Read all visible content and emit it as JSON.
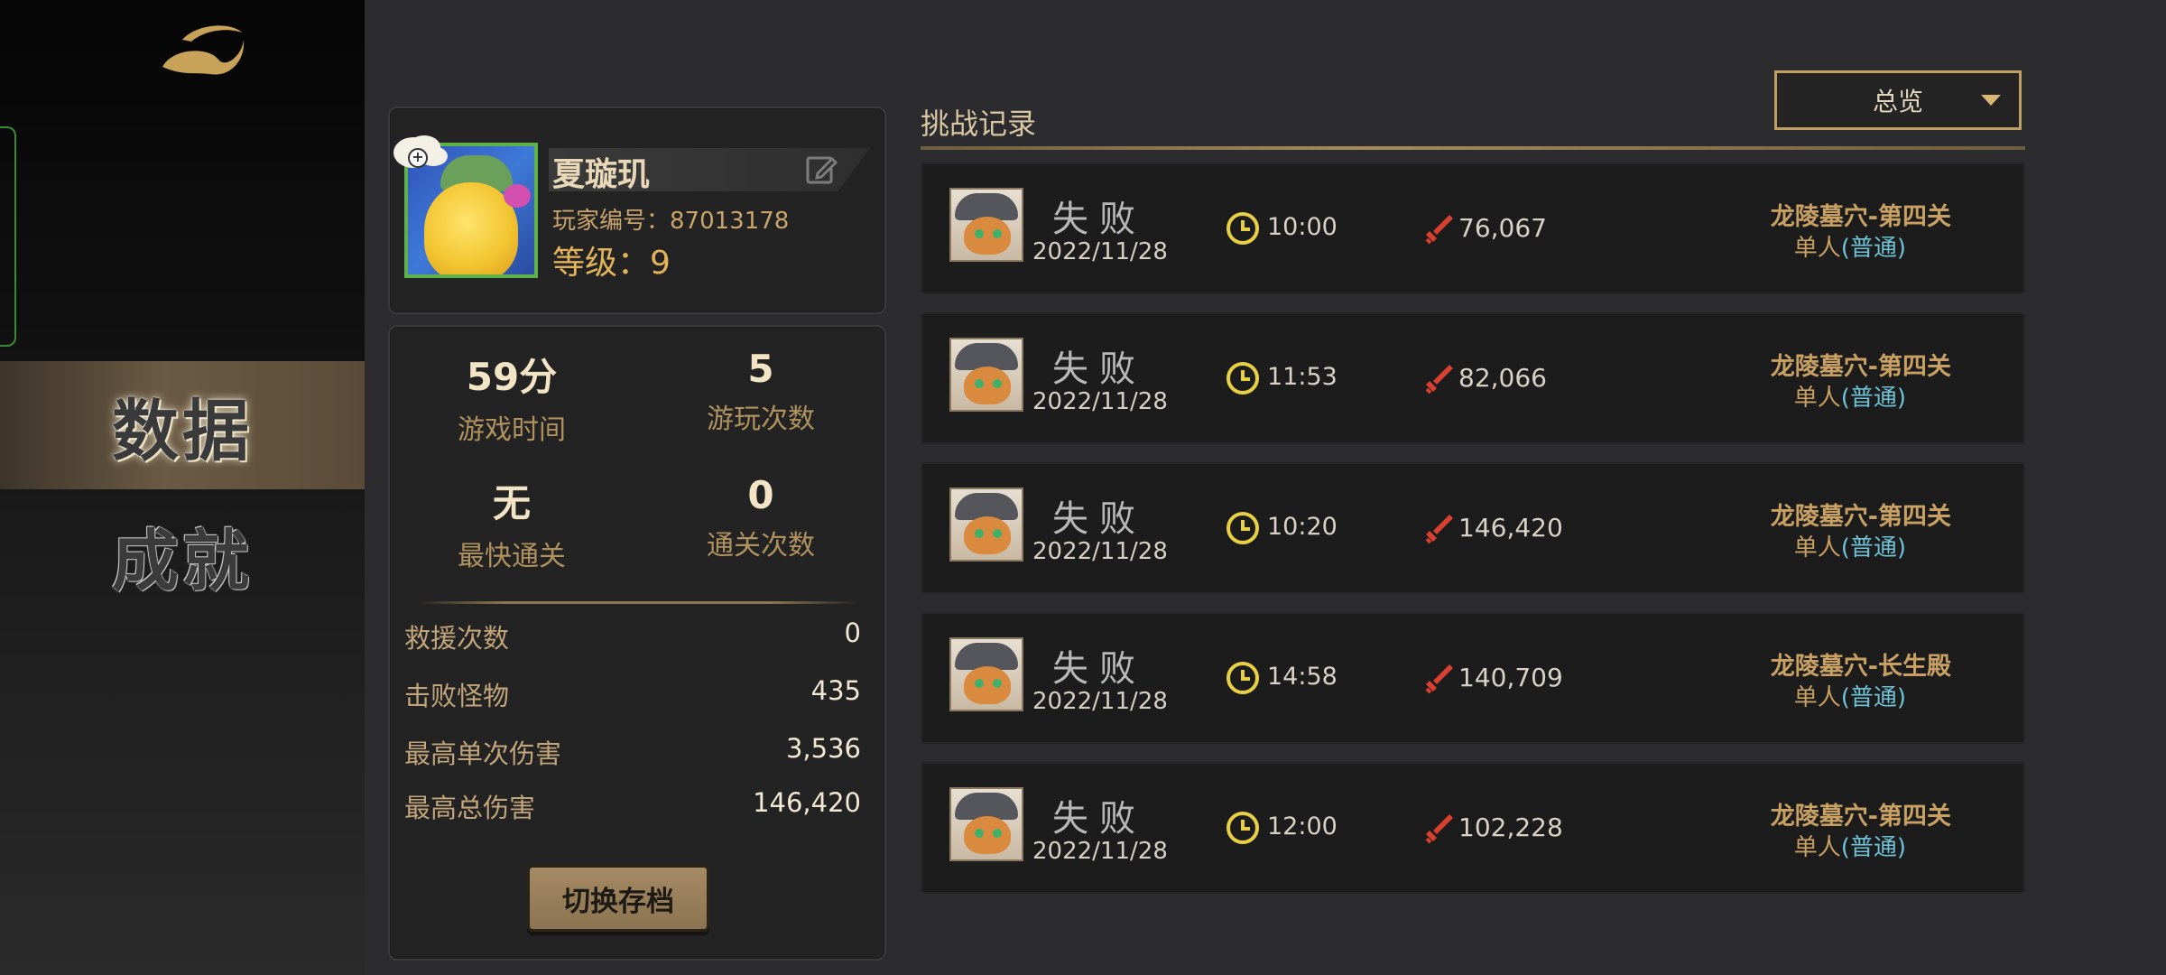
{
  "nav": {
    "data_label": "数据",
    "achievement_label": "成就"
  },
  "profile": {
    "name": "夏璇玑",
    "player_id": "玩家编号：87013178",
    "level": "等级：9"
  },
  "stats": {
    "play_time": {
      "value": "59分",
      "label": "游戏时间"
    },
    "play_count": {
      "value": "5",
      "label": "游玩次数"
    },
    "fastest_clear": {
      "value": "无",
      "label": "最快通关"
    },
    "clear_count": {
      "value": "0",
      "label": "通关次数"
    },
    "rows": [
      {
        "label": "救援次数",
        "value": "0"
      },
      {
        "label": "击败怪物",
        "value": "435"
      },
      {
        "label": "最高单次伤害",
        "value": "3,536"
      },
      {
        "label": "最高总伤害",
        "value": "146,420"
      }
    ],
    "switch_button": "切换存档"
  },
  "records": {
    "title": "挑战记录",
    "filter": "总览",
    "items": [
      {
        "result": "失败",
        "date": "2022/11/28",
        "time": "10:00",
        "damage": "76,067",
        "stage": "龙陵墓穴-第四关",
        "mode": "单人",
        "difficulty": "(普通)"
      },
      {
        "result": "失败",
        "date": "2022/11/28",
        "time": "11:53",
        "damage": "82,066",
        "stage": "龙陵墓穴-第四关",
        "mode": "单人",
        "difficulty": "(普通)"
      },
      {
        "result": "失败",
        "date": "2022/11/28",
        "time": "10:20",
        "damage": "146,420",
        "stage": "龙陵墓穴-第四关",
        "mode": "单人",
        "difficulty": "(普通)"
      },
      {
        "result": "失败",
        "date": "2022/11/28",
        "time": "14:58",
        "damage": "140,709",
        "stage": "龙陵墓穴-长生殿",
        "mode": "单人",
        "difficulty": "(普通)"
      },
      {
        "result": "失败",
        "date": "2022/11/28",
        "time": "12:00",
        "damage": "102,228",
        "stage": "龙陵墓穴-第四关",
        "mode": "单人",
        "difficulty": "(普通)"
      }
    ]
  },
  "colors": {
    "accent_gold": "#c8a062",
    "difficulty_cyan": "#6ec4d6",
    "damage_red": "#d8402f",
    "clock_yellow": "#e8d040"
  }
}
